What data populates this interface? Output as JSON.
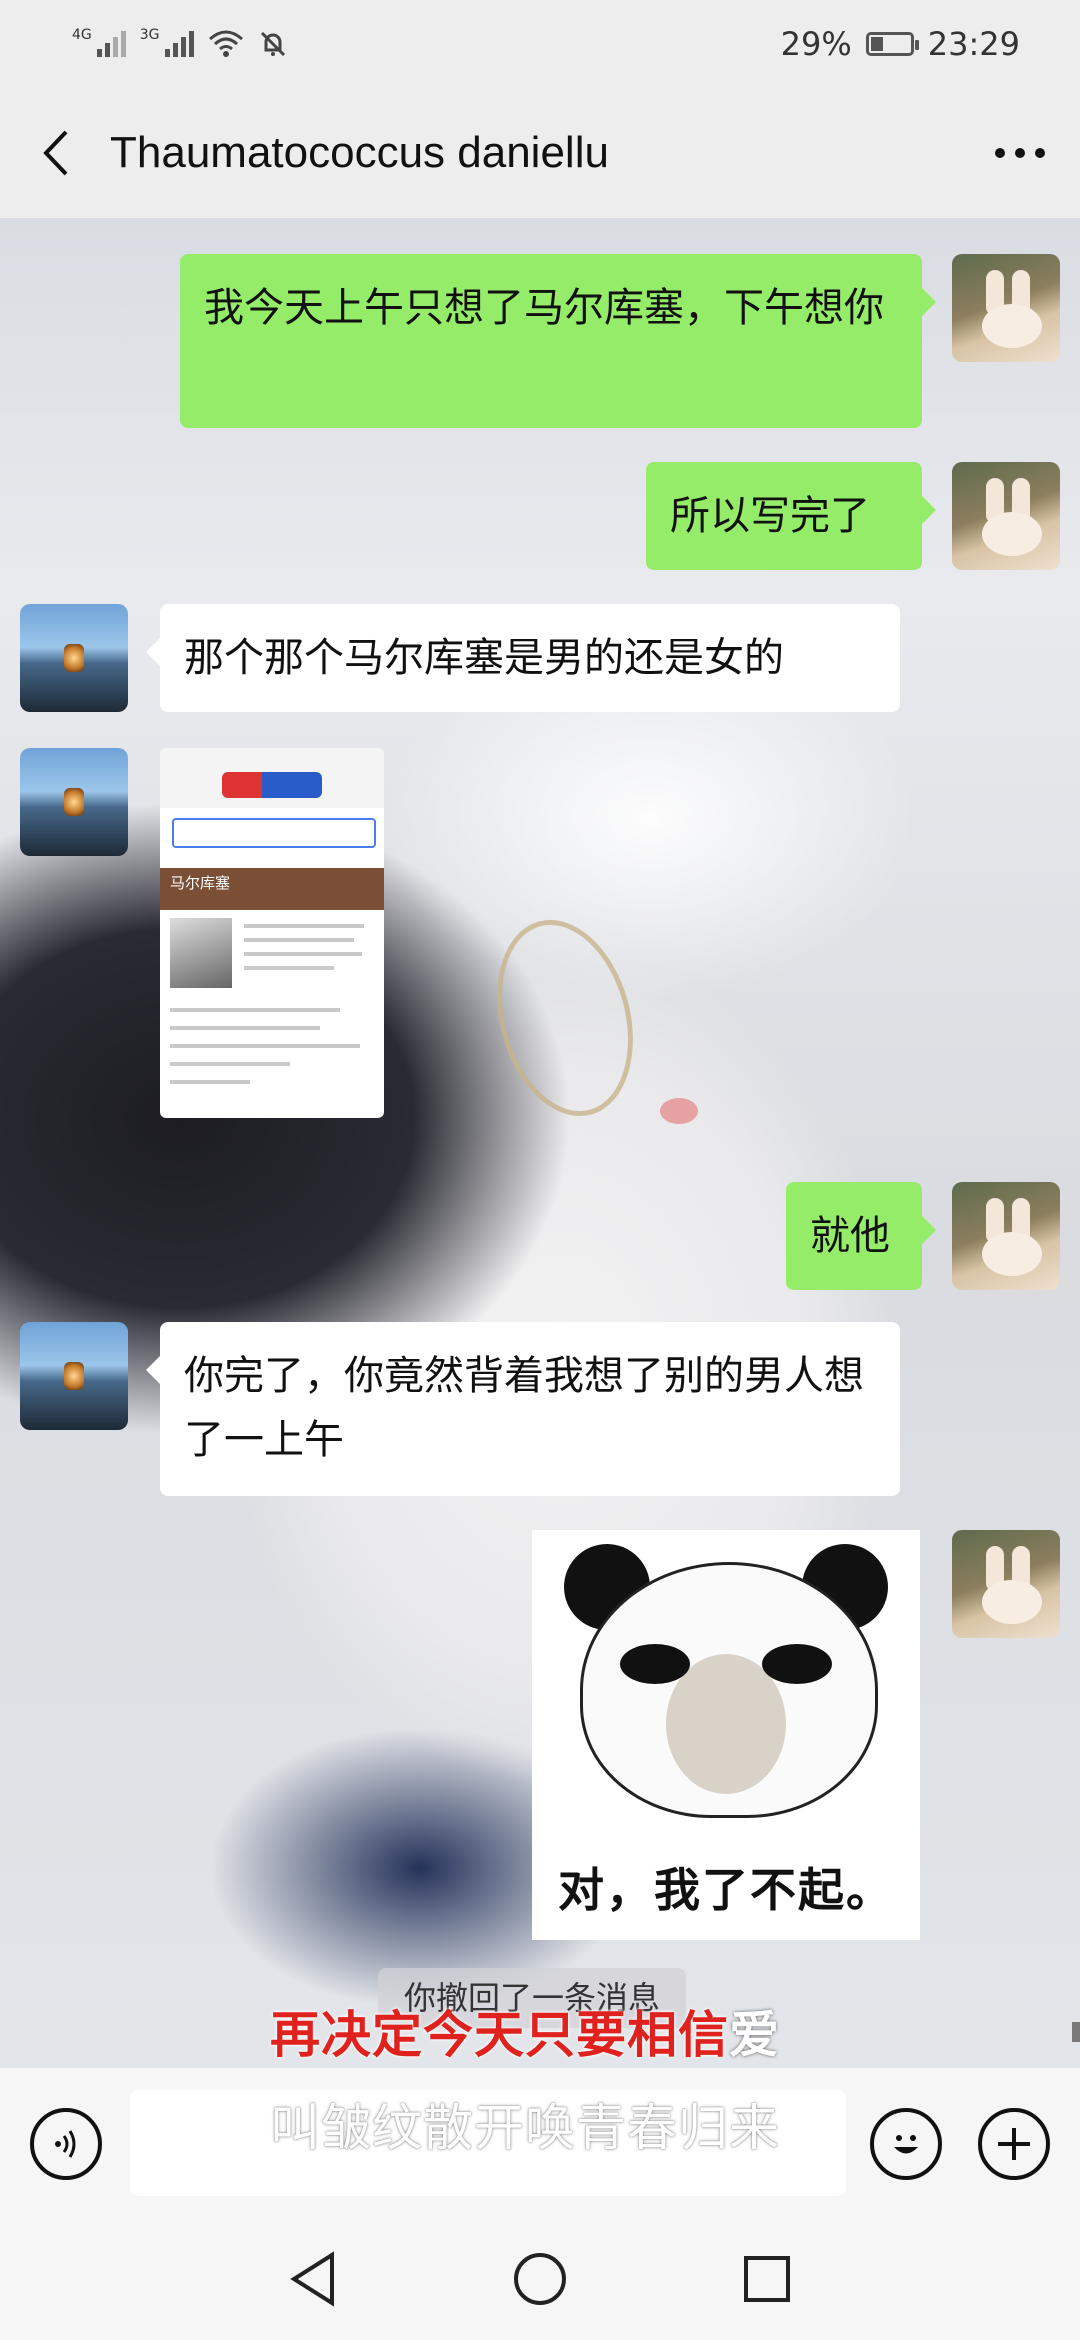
{
  "status": {
    "net1": "4G",
    "net2": "3G",
    "battery": "29%",
    "battery_level": 0.29,
    "time": "23:29"
  },
  "header": {
    "title": "Thaumatococcus daniellu"
  },
  "messages": [
    {
      "side": "me",
      "text": "我今天上午只想了马尔库塞，下午想你"
    },
    {
      "side": "me",
      "text": "所以写完了"
    },
    {
      "side": "other",
      "text": "那个那个马尔库塞是男的还是女的"
    },
    {
      "side": "other",
      "type": "image",
      "text": "马尔库塞"
    },
    {
      "side": "me",
      "text": "就他"
    },
    {
      "side": "other",
      "text": "你完了，你竟然背着我想了别的男人想了一上午"
    },
    {
      "side": "me",
      "type": "sticker",
      "text": "对，我了不起。"
    }
  ],
  "notice": "你撤回了一条消息",
  "lyrics": {
    "line1_red": "再决定今天只要相信",
    "line1_rest": "爱",
    "line2": "叫皱纹散开唤青春归来"
  },
  "icons": {
    "voice": "voice-icon",
    "emoji": "emoji-icon",
    "plus": "plus-icon",
    "back": "chevron-left-icon",
    "more": "more-icon"
  },
  "colors": {
    "my_bubble": "#95ec69",
    "other_bubble": "#ffffff",
    "lyric_red": "#e0221f"
  }
}
